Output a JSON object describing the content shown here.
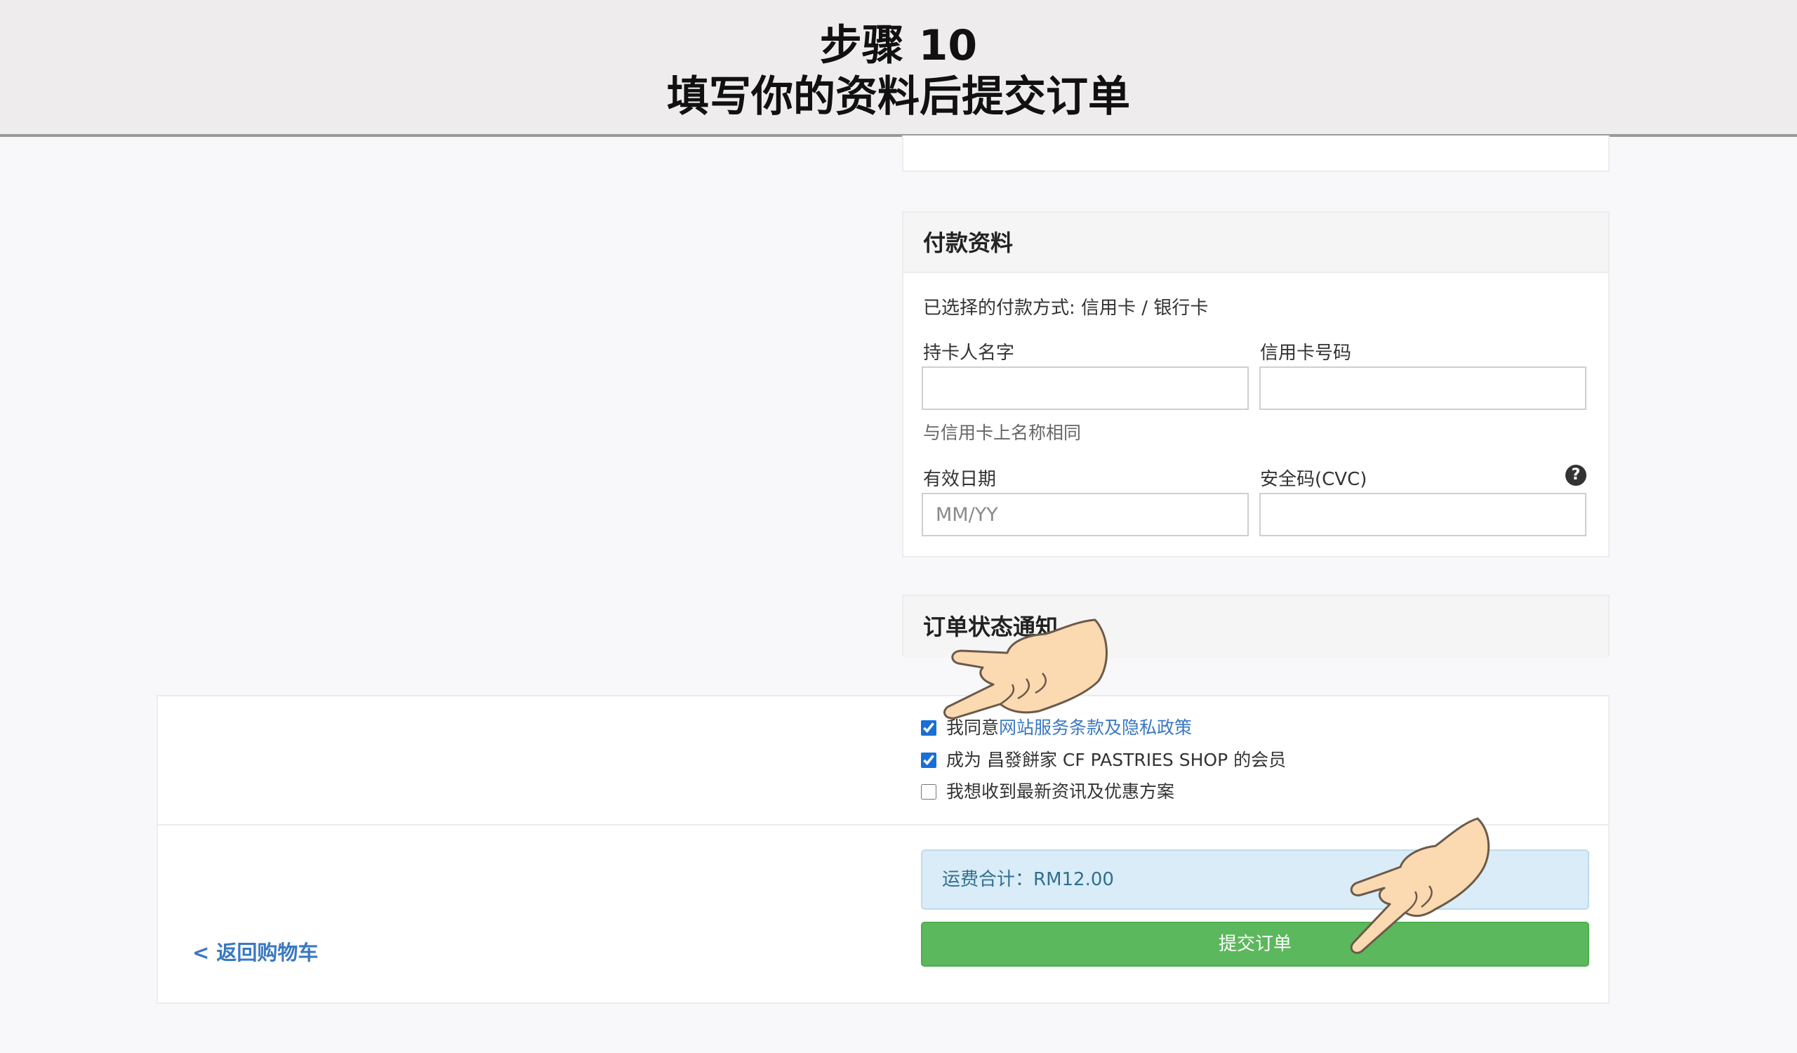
{
  "banner": {
    "step": "步骤 10",
    "instruction": "填写你的资料后提交订单"
  },
  "payment": {
    "title": "付款资料",
    "selected_method": "已选择的付款方式: 信用卡 / 银行卡",
    "cardholder_label": "持卡人名字",
    "cardholder_value": "",
    "cardholder_hint": "与信用卡上名称相同",
    "card_number_label": "信用卡号码",
    "card_number_value": "",
    "expiry_label": "有效日期",
    "expiry_placeholder": "MM/YY",
    "cvc_label": "安全码(CVC)",
    "cvc_value": ""
  },
  "notification": {
    "title": "订单状态通知"
  },
  "agreements": {
    "terms_prefix": "我同意",
    "terms_link": "网站服务条款及隐私政策",
    "terms_checked": true,
    "member": "成为 昌發餅家 CF PASTRIES SHOP 的会员",
    "member_checked": true,
    "newsletter": "我想收到最新资讯及优惠方案",
    "newsletter_checked": false
  },
  "summary": {
    "shipping": "运费合计：RM12.00"
  },
  "actions": {
    "submit_label": "提交订单",
    "back_label": "< 返回购物车"
  },
  "icons": {
    "help": "question-circle-icon",
    "pointer": "pointing-hand-icon"
  },
  "colors": {
    "submit": "#5cb85c",
    "link": "#3a78c2",
    "info_bg": "#d9ecf7",
    "checkbox": "#1a6fd6"
  }
}
